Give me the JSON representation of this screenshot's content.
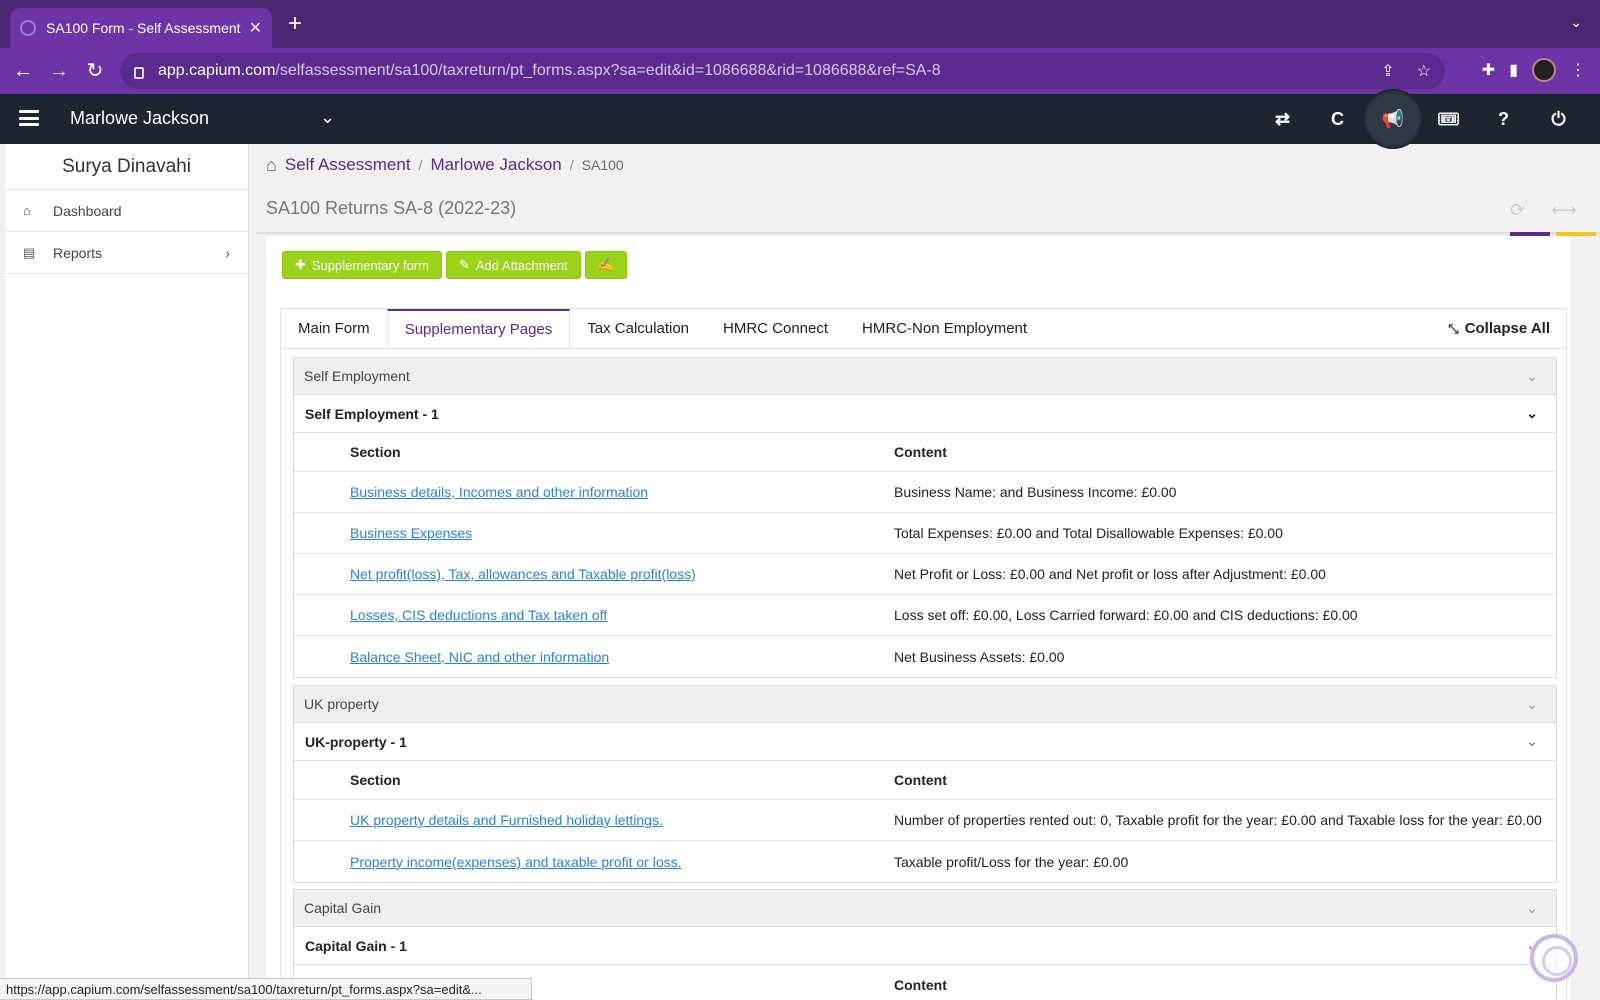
{
  "browser": {
    "tab_title": "SA100 Form - Self Assessment",
    "new_tab": "+",
    "url_host": "app.capium.com",
    "url_path": "/selfassessment/sa100/taxreturn/pt_forms.aspx?sa=edit&id=1086688&rid=1086688&ref=SA-8",
    "status_url": "https://app.capium.com/selfassessment/sa100/taxreturn/pt_forms.aspx?sa=edit&..."
  },
  "appbar": {
    "client_name": "Marlowe Jackson"
  },
  "sidebar": {
    "user_name": "Surya Dinavahi",
    "items": [
      {
        "label": "Dashboard"
      },
      {
        "label": "Reports"
      }
    ]
  },
  "breadcrumb": {
    "items": [
      "Self Assessment",
      "Marlowe Jackson"
    ],
    "current": "SA100"
  },
  "page": {
    "title": "SA100 Returns SA-8 (2022-23)"
  },
  "buttons": {
    "supplementary": "Supplementary form",
    "attachment": "Add Attachment"
  },
  "tabs": {
    "items": [
      "Main Form",
      "Supplementary Pages",
      "Tax Calculation",
      "HMRC Connect",
      "HMRC-Non Employment"
    ],
    "active": "Supplementary Pages",
    "collapse_all": "Collapse All"
  },
  "groups": [
    {
      "title": "Self Employment",
      "sub_title": "Self Employment - 1",
      "col_section": "Section",
      "col_content": "Content",
      "rows": [
        {
          "section": "Business details, Incomes and other information",
          "content": "Business Name: and Business Income: £0.00"
        },
        {
          "section": "Business Expenses",
          "content": "Total Expenses: £0.00 and Total Disallowable Expenses: £0.00"
        },
        {
          "section": "Net profit(loss), Tax, allowances and Taxable profit(loss)",
          "content": "Net Profit or Loss: £0.00 and Net profit or loss after Adjustment: £0.00"
        },
        {
          "section": "Losses, CIS deductions and Tax taken off",
          "content": "Loss set off: £0.00, Loss Carried forward: £0.00 and CIS deductions: £0.00"
        },
        {
          "section": "Balance Sheet, NIC and other information",
          "content": "Net Business Assets: £0.00"
        }
      ]
    },
    {
      "title": "UK property",
      "sub_title": "UK-property - 1",
      "col_section": "Section",
      "col_content": "Content",
      "rows": [
        {
          "section": "UK property details and Furnished holiday lettings.",
          "content": "Number of properties rented out: 0, Taxable profit for the year: £0.00 and Taxable loss for the year: £0.00"
        },
        {
          "section": "Property income(expenses) and taxable profit or loss.",
          "content": "Taxable profit/Loss for the year: £0.00"
        }
      ]
    },
    {
      "title": "Capital Gain",
      "sub_title": "Capital Gain - 1",
      "col_content": "Content"
    }
  ]
}
